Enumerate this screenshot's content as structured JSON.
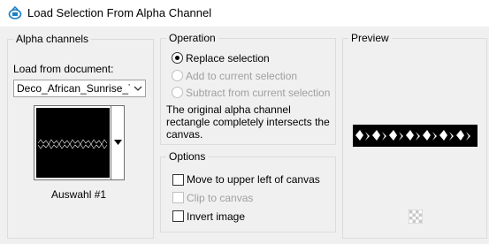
{
  "window": {
    "title": "Load Selection From Alpha Channel",
    "icon": "selection-app-icon"
  },
  "alpha_channels": {
    "group_label": "Alpha channels",
    "load_from_label": "Load from document:",
    "document_value": "Deco_African_Sunrise_Ts",
    "channel_name": "Auswahl #1"
  },
  "operation": {
    "group_label": "Operation",
    "options": [
      {
        "label": "Replace selection",
        "selected": true,
        "enabled": true
      },
      {
        "label": "Add to current selection",
        "selected": false,
        "enabled": false
      },
      {
        "label": "Subtract from current selection",
        "selected": false,
        "enabled": false
      }
    ],
    "description": "The original alpha channel rectangle completely intersects the canvas."
  },
  "options": {
    "group_label": "Options",
    "checkboxes": [
      {
        "label": "Move to upper left of canvas",
        "checked": false,
        "enabled": true
      },
      {
        "label": "Clip to canvas",
        "checked": false,
        "enabled": false
      },
      {
        "label": "Invert image",
        "checked": false,
        "enabled": true
      }
    ]
  },
  "preview": {
    "group_label": "Preview"
  },
  "colors": {
    "disabled_text": "#a0a0a0",
    "group_border": "#dcdcdc",
    "background": "#f0f0f0",
    "preview_fill": "#000000"
  }
}
